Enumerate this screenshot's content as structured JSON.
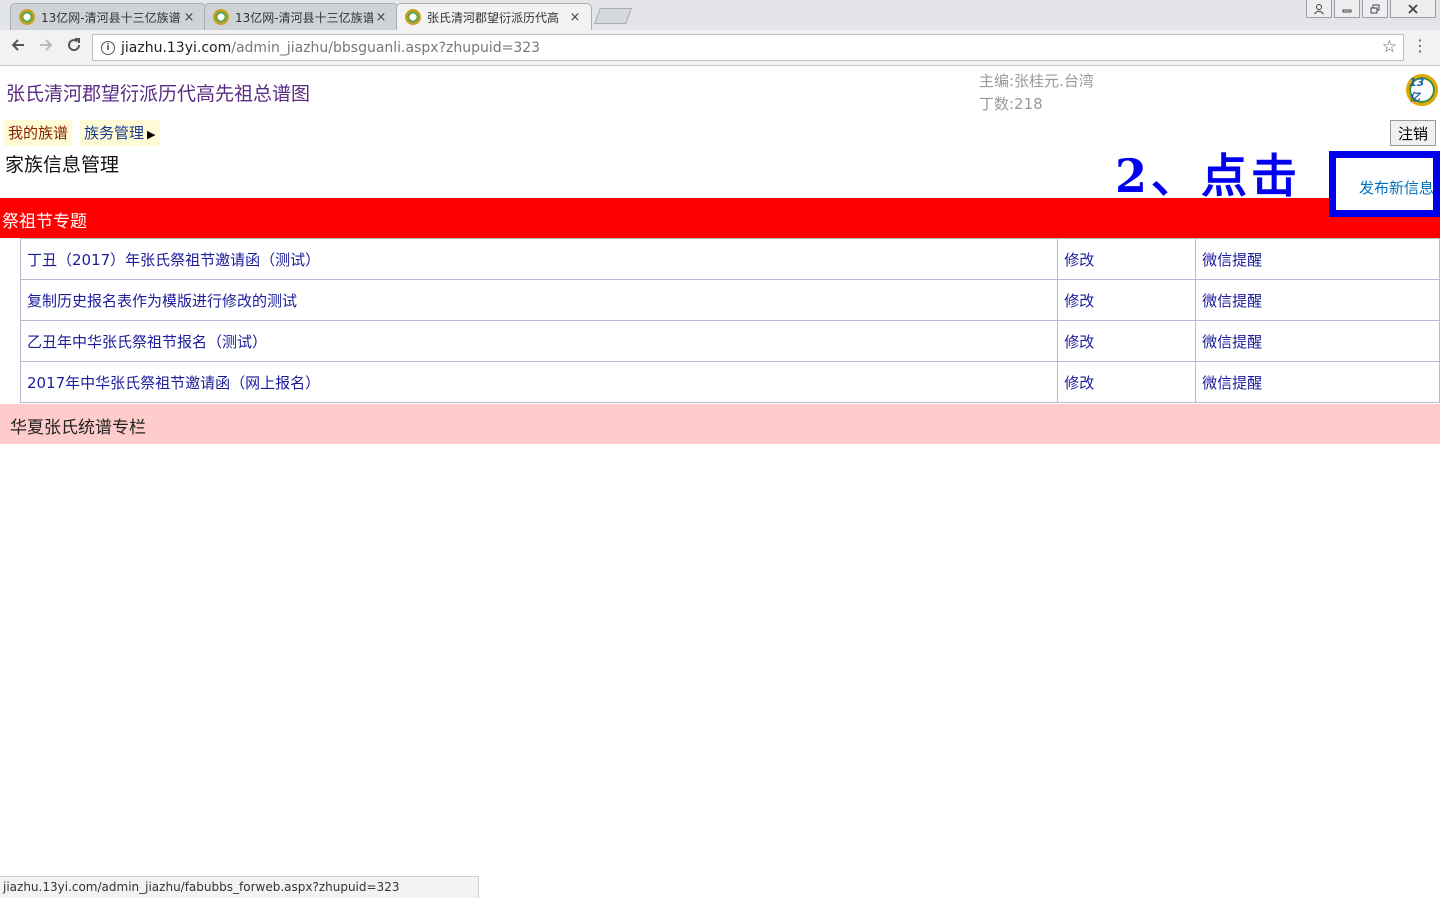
{
  "browser": {
    "tabs": [
      {
        "title": "13亿网-清河县十三亿族谱",
        "active": false
      },
      {
        "title": "13亿网-清河县十三亿族谱",
        "active": false
      },
      {
        "title": "张氏清河郡望衍派历代高",
        "active": true
      }
    ],
    "close_glyph": "×",
    "url_host": "jiazhu.13yi.com",
    "url_path": "/admin_jiazhu/bbsguanli.aspx?zhupuid=323",
    "status_url": "jiazhu.13yi.com/admin_jiazhu/fabubbs_forweb.aspx?zhupuid=323"
  },
  "header": {
    "site_title": "张氏清河郡望衍派历代高先祖总谱图",
    "editor": "主编:张桂元.台湾",
    "member_count": "丁数:218",
    "logo_text": "13亿"
  },
  "nav": {
    "my_genealogy": "我的族谱",
    "clan_management": "族务管理",
    "logout": "注销"
  },
  "main": {
    "heading": "家族信息管理",
    "annotation": "2、点击",
    "publish_link": "发布新信息",
    "section1": {
      "title": "祭祖节专题",
      "rows": [
        {
          "title": "丁丑（2017）年张氏祭祖节邀请函（测试）",
          "edit": "修改",
          "wechat": "微信提醒"
        },
        {
          "title": "复制历史报名表作为模版进行修改的测试",
          "edit": "修改",
          "wechat": "微信提醒"
        },
        {
          "title": "乙丑年中华张氏祭祖节报名（测试）",
          "edit": "修改",
          "wechat": "微信提醒"
        },
        {
          "title": "2017年中华张氏祭祖节邀请函（网上报名）",
          "edit": "修改",
          "wechat": "微信提醒"
        }
      ]
    },
    "section2": {
      "title": "华夏张氏统谱专栏"
    }
  },
  "colors": {
    "section1_bg": "#ff0000",
    "section2_bg": "#ffcccc",
    "highlight": "#0000ee",
    "link": "#1c1c9c"
  }
}
